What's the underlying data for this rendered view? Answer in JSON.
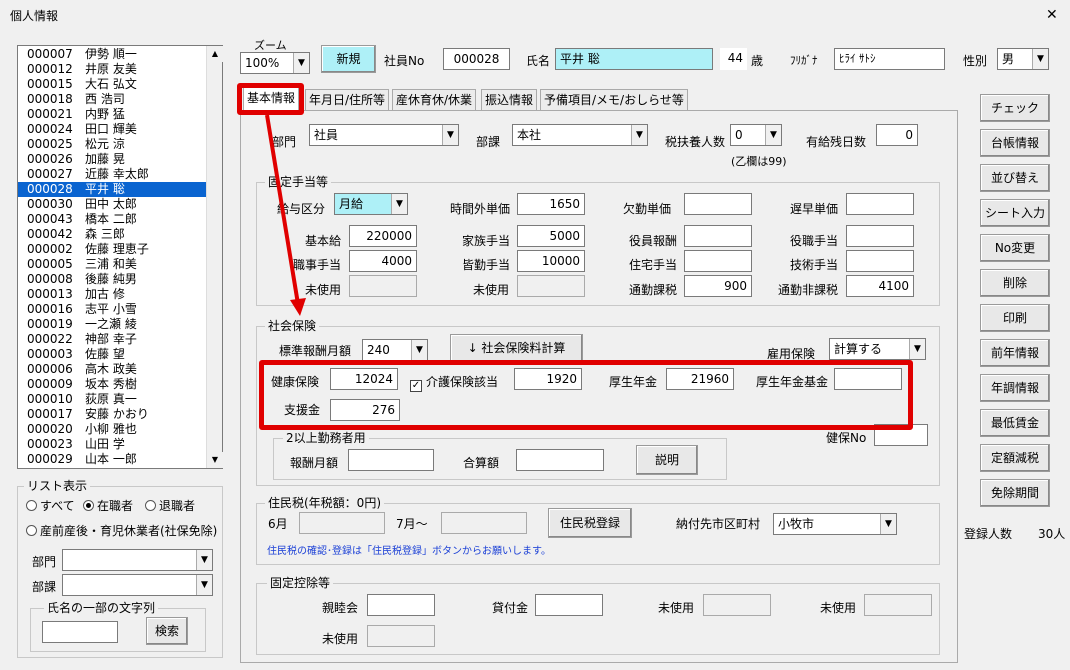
{
  "window": {
    "title": "個人情報",
    "close_glyph": "✕"
  },
  "top": {
    "zoom_label": "ズーム",
    "zoom_value": "100%",
    "new_button": "新規",
    "emp_no_label": "社員No",
    "emp_no": "000028",
    "name_label": "氏名",
    "name": "平井 聡",
    "age": "44",
    "age_unit": "歳",
    "kana_label": "ﾌﾘｶﾞﾅ",
    "kana": "ﾋﾗｲ ｻﾄｼ",
    "gender_label": "性別",
    "gender": "男"
  },
  "employees": [
    {
      "no": "000007",
      "name": "伊勢 順一"
    },
    {
      "no": "000012",
      "name": "井原 友美"
    },
    {
      "no": "000015",
      "name": "大石 弘文"
    },
    {
      "no": "000018",
      "name": "西 浩司"
    },
    {
      "no": "000021",
      "name": "内野 猛"
    },
    {
      "no": "000024",
      "name": "田口 輝美"
    },
    {
      "no": "000025",
      "name": "松元 涼"
    },
    {
      "no": "000026",
      "name": "加藤 晃"
    },
    {
      "no": "000027",
      "name": "近藤 幸太郎"
    },
    {
      "no": "000028",
      "name": "平井 聡"
    },
    {
      "no": "000030",
      "name": "田中 太郎"
    },
    {
      "no": "000043",
      "name": "橋本 二郎"
    },
    {
      "no": "000042",
      "name": "森 三郎"
    },
    {
      "no": "000002",
      "name": "佐藤 理恵子"
    },
    {
      "no": "000005",
      "name": "三浦 和美"
    },
    {
      "no": "000008",
      "name": "後藤 純男"
    },
    {
      "no": "000013",
      "name": "加古 修"
    },
    {
      "no": "000016",
      "name": "志平 小雪"
    },
    {
      "no": "000019",
      "name": "一之瀬 綾"
    },
    {
      "no": "000022",
      "name": "神部 幸子"
    },
    {
      "no": "000003",
      "name": "佐藤 望"
    },
    {
      "no": "000006",
      "name": "高木 政美"
    },
    {
      "no": "000009",
      "name": "坂本 秀樹"
    },
    {
      "no": "000010",
      "name": "荻原 真一"
    },
    {
      "no": "000017",
      "name": "安藤 かおり"
    },
    {
      "no": "000020",
      "name": "小柳 雅也"
    },
    {
      "no": "000023",
      "name": "山田 学"
    },
    {
      "no": "000029",
      "name": "山本 一郎"
    }
  ],
  "selected_index": 9,
  "list_filter": {
    "title": "リスト表示",
    "all": "すべて",
    "active": "在職者",
    "retired": "退職者",
    "leave": "産前産後・育児休業者(社保免除)",
    "dept_label": "部門",
    "section_label": "部課",
    "name_search_title": "氏名の一部の文字列",
    "search_button": "検索"
  },
  "tabs": [
    "基本情報",
    "年月日/住所等",
    "産休育休/休業",
    "振込情報",
    "予備項目/メモ/おしらせ等"
  ],
  "basic": {
    "dept_label": "部門",
    "dept": "社員",
    "section_label": "部課",
    "section": "本社",
    "dependents_label": "税扶養人数",
    "dependents": "0",
    "dependents_note": "(乙欄は99)",
    "paid_leave_label": "有給残日数",
    "paid_leave": "0"
  },
  "fixed_allowance": {
    "title": "固定手当等",
    "pay_type_label": "給与区分",
    "pay_type": "月給",
    "overtime_label": "時間外単価",
    "overtime": "1650",
    "absence_label": "欠勤単価",
    "absence": "",
    "late_label": "遅早単価",
    "late": "",
    "base_label": "基本給",
    "base": "220000",
    "family_label": "家族手当",
    "family": "5000",
    "exec_label": "役員報酬",
    "exec": "",
    "position_label": "役職手当",
    "position": "",
    "duty_label": "職事手当",
    "duty": "4000",
    "attendance_label": "皆勤手当",
    "attendance": "10000",
    "housing_label": "住宅手当",
    "housing": "",
    "skill_label": "技術手当",
    "skill": "",
    "unused1_label": "未使用",
    "unused2_label": "未使用",
    "commute_tax_label": "通勤課税",
    "commute_tax": "900",
    "commute_nontax_label": "通勤非課税",
    "commute_nontax": "4100"
  },
  "social_insurance": {
    "title": "社会保険",
    "std_label": "標準報酬月額",
    "std": "240",
    "calc_button": "↓ 社会保険料計算",
    "employment_label": "雇用保険",
    "employment": "計算する",
    "health_label": "健康保険",
    "health": "12024",
    "care_label": "介護保険該当",
    "care": "1920",
    "pension_label": "厚生年金",
    "pension": "21960",
    "pension_fund_label": "厚生年金基金",
    "pension_fund": "",
    "support_label": "支援金",
    "support": "276",
    "health_no_label": "健保No",
    "health_no": "",
    "dual_title": "2以上勤務者用",
    "dual_pay_label": "報酬月額",
    "dual_total_label": "合算額",
    "explain_button": "説明"
  },
  "resident_tax": {
    "title": "住民税(年税額：0円)",
    "june_label": "6月",
    "july_label": "7月～",
    "register_button": "住民税登録",
    "city_label": "納付先市区町村",
    "city": "小牧市",
    "note": "住民税の確認･登録は「住民税登録」ボタンからお願いします。"
  },
  "fixed_deduction": {
    "title": "固定控除等",
    "social_club_label": "親睦会",
    "loan_label": "貸付金",
    "unused_a": "未使用",
    "unused_b": "未使用",
    "unused_c": "未使用"
  },
  "side_buttons": [
    "チェック",
    "台帳情報",
    "並び替え",
    "シート入力",
    "No変更",
    "削除",
    "印刷",
    "前年情報",
    "年調情報",
    "最低賃金",
    "定額減税",
    "免除期間"
  ],
  "registered": {
    "label": "登録人数",
    "count": "30人"
  },
  "colors": {
    "annotation_red": "#e00000",
    "selection_blue": "#0a64d0",
    "cyan_field": "#aef0f7"
  }
}
